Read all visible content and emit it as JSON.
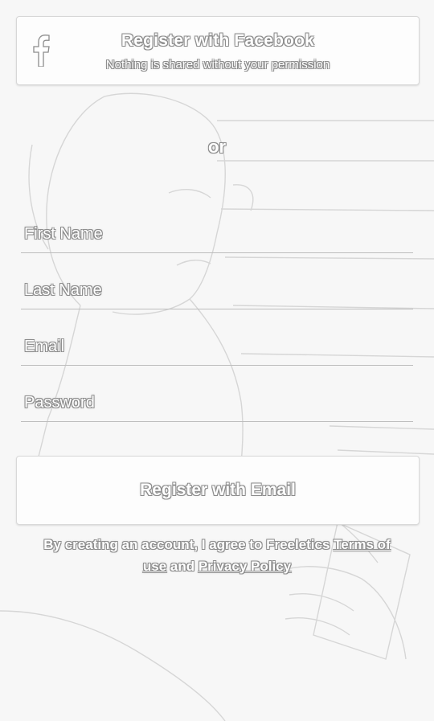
{
  "facebook": {
    "title": "Register with Facebook",
    "subtitle": "Nothing is shared without your permission",
    "icon": "facebook-icon"
  },
  "divider": {
    "label": "or"
  },
  "form": {
    "first_name_placeholder": "First Name",
    "last_name_placeholder": "Last Name",
    "email_placeholder": "Email",
    "password_placeholder": "Password"
  },
  "email_button": {
    "label": "Register with Email"
  },
  "terms": {
    "prefix": "By creating an account, I agree to Freeletics ",
    "terms_link": "Terms of use",
    "and": " and ",
    "privacy_link": "Privacy Policy"
  },
  "colors": {
    "background": "#f7f7f7",
    "outline": "#8c8c8c"
  }
}
